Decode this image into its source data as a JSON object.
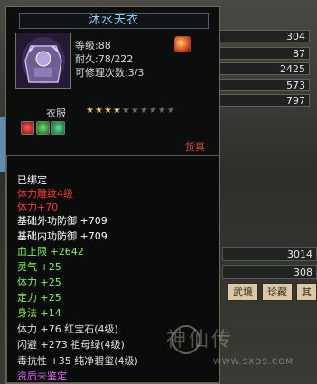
{
  "item": {
    "name": "沐水天衣",
    "level": "等级:88",
    "durability": "耐久:78/222",
    "repairs": "可修理次数:3/3",
    "type": "衣服",
    "stars_filled": 4,
    "stars_total": 10,
    "treasure_label": "货真"
  },
  "attributes": [
    {
      "text": "已绑定",
      "color": "white"
    },
    {
      "text": "体力雕纹4级",
      "color": "red"
    },
    {
      "text": "体力+70",
      "color": "red"
    },
    {
      "text": "基础外功防御 +709",
      "color": "white"
    },
    {
      "text": "基础内功防御 +709",
      "color": "white"
    },
    {
      "text": "血上限 +2642",
      "color": "green"
    },
    {
      "text": "灵气 +25",
      "color": "green"
    },
    {
      "text": "体力 +25",
      "color": "green"
    },
    {
      "text": "定力 +25",
      "color": "green"
    },
    {
      "text": "身法 +14",
      "color": "green"
    },
    {
      "text": "体力 +76 红宝石(4级)",
      "color": "gray"
    },
    {
      "text": "闪避 +273 祖母绿(4级)",
      "color": "gray"
    },
    {
      "text": "毒抗性 +35 纯净碧玺(4级)",
      "color": "gray"
    },
    {
      "text": "资质未鉴定",
      "color": "purple"
    }
  ],
  "background_stats": [
    "304",
    "87",
    "2425",
    "573",
    "797"
  ],
  "background_wide": [
    "3014",
    "308"
  ],
  "background_tabs": [
    "武境",
    "珍藏",
    "其"
  ],
  "watermark": {
    "text": "神仙传",
    "url": "WWW.SXDS.COM"
  }
}
